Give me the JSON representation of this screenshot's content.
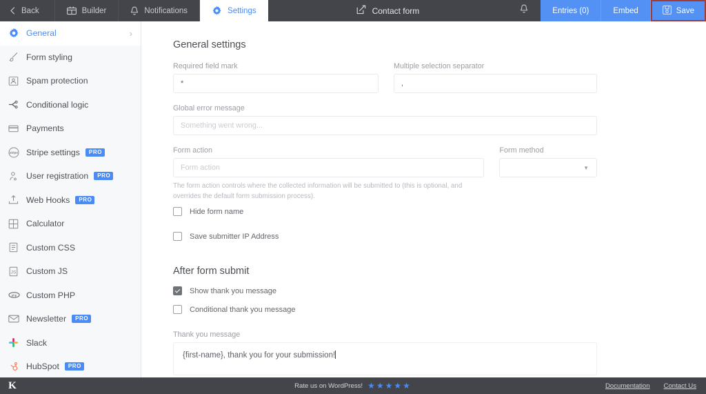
{
  "topbar": {
    "back": "Back",
    "tabs": [
      {
        "label": "Builder",
        "icon": "builder-icon",
        "active": false
      },
      {
        "label": "Notifications",
        "icon": "bell-icon",
        "active": false
      },
      {
        "label": "Settings",
        "icon": "gear-icon",
        "active": true
      }
    ],
    "form_title": "Contact form",
    "bell_icon": "bell-icon",
    "entries_label": "Entries (0)",
    "embed_label": "Embed",
    "save_label": "Save",
    "accent_blue": "#5491f4",
    "bar_dark": "#43454a",
    "highlight_red": "#a33b36"
  },
  "sidebar": {
    "items": [
      {
        "label": "General",
        "icon": "gear-icon",
        "pro": false,
        "active": true,
        "chevron": "›"
      },
      {
        "label": "Form styling",
        "icon": "brush-icon",
        "pro": false,
        "active": false
      },
      {
        "label": "Spam protection",
        "icon": "shield-person-icon",
        "pro": false,
        "active": false
      },
      {
        "label": "Conditional logic",
        "icon": "branch-icon",
        "pro": false,
        "active": false
      },
      {
        "label": "Payments",
        "icon": "credit-card-icon",
        "pro": false,
        "active": false
      },
      {
        "label": "Stripe settings",
        "icon": "stripe-icon",
        "pro": true,
        "active": false
      },
      {
        "label": "User registration",
        "icon": "user-icon",
        "pro": true,
        "active": false
      },
      {
        "label": "Web Hooks",
        "icon": "upload-icon",
        "pro": true,
        "active": false
      },
      {
        "label": "Calculator",
        "icon": "calculator-icon",
        "pro": false,
        "active": false
      },
      {
        "label": "Custom CSS",
        "icon": "css-file-icon",
        "pro": false,
        "active": false
      },
      {
        "label": "Custom JS",
        "icon": "js-file-icon",
        "pro": false,
        "active": false
      },
      {
        "label": "Custom PHP",
        "icon": "php-elephant-icon",
        "pro": false,
        "active": false
      },
      {
        "label": "Newsletter",
        "icon": "envelope-icon",
        "pro": true,
        "active": false
      },
      {
        "label": "Slack",
        "icon": "slack-icon",
        "pro": false,
        "active": false
      },
      {
        "label": "HubSpot",
        "icon": "hubspot-icon",
        "pro": true,
        "active": false
      }
    ],
    "pro_badge": "PRO"
  },
  "main": {
    "general_heading": "General settings",
    "required_field_mark": {
      "label": "Required field mark",
      "value": "*"
    },
    "multiple_selection_separator": {
      "label": "Multiple selection separator",
      "value": ","
    },
    "global_error_message": {
      "label": "Global error message",
      "placeholder": "Something went wrong..."
    },
    "form_action": {
      "label": "Form action",
      "placeholder": "Form action",
      "help": "The form action controls where the collected information will be submitted to (this is optional, and overrides the default form submission process)."
    },
    "form_method": {
      "label": "Form method",
      "value": ""
    },
    "hide_form_name": {
      "label": "Hide form name",
      "checked": false
    },
    "save_submitter_ip": {
      "label": "Save submitter IP Address",
      "checked": false
    },
    "after_submit_heading": "After form submit",
    "show_thank_you": {
      "label": "Show thank you message",
      "checked": true
    },
    "conditional_thank_you": {
      "label": "Conditional thank you message",
      "checked": false
    },
    "thank_you_message": {
      "label": "Thank you message",
      "value": "{first-name}, thank you for your submission!"
    }
  },
  "annotation": {
    "arrow_color": "#b4504a",
    "target": "save-button"
  },
  "footer": {
    "logo": "K",
    "rate_text": "Rate us on WordPress!",
    "stars": "★★★★★",
    "documentation": "Documentation",
    "contact_us": "Contact Us"
  }
}
